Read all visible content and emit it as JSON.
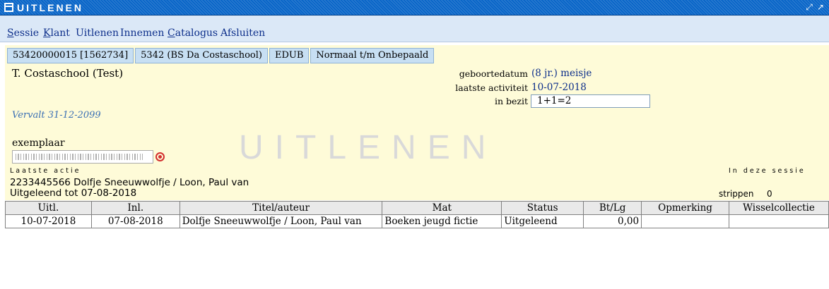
{
  "window": {
    "title": "UITLENEN",
    "restore_icon": "restore-icon",
    "maximize_icon": "maximize-icon"
  },
  "menu": [
    {
      "label": "Sessie",
      "underline": "S",
      "rest": "essie"
    },
    {
      "label": "Klant",
      "underline": "K",
      "rest": "lant"
    },
    {
      "label": "Uitlenen"
    },
    {
      "label": "Innemen"
    },
    {
      "label": "Catalogus",
      "underline": "C",
      "rest": "atalogus"
    },
    {
      "label": "Afsluiten"
    }
  ],
  "tabs": [
    "53420000015 [1562734]",
    "5342 (BS Da Costaschool)",
    "EDUB",
    "Normaal t/m Onbepaald"
  ],
  "patron": {
    "name": "T. Costaschool (Test)",
    "birthdate_label": "geboortedatum",
    "birthdate_value": "(8 jr.) meisje",
    "last_activity_label": "laatste activiteit",
    "last_activity_value": "10-07-2018",
    "in_possession_label": "in bezit",
    "in_possession_value": "1+1=2",
    "expires": "Vervalt 31-12-2099"
  },
  "scan": {
    "label": "exemplaar",
    "value": "",
    "target_icon": "target-icon"
  },
  "watermark": "UITLENEN",
  "last_action": {
    "label": "Laatste actie",
    "item": "2233445566 Dolfje Sneeuwwolfje / Loon, Paul van",
    "due": "Uitgeleend tot 07-08-2018"
  },
  "session": {
    "label": "In deze sessie",
    "strippen_label": "strippen",
    "strippen_value": "0"
  },
  "table": {
    "columns": [
      "Uitl.",
      "Inl.",
      "Titel/auteur",
      "Mat",
      "Status",
      "Bt/Lg",
      "Opmerking",
      "Wisselcollectie"
    ],
    "rows": [
      [
        "10-07-2018",
        "07-08-2018",
        "Dolfje Sneeuwwolfje / Loon, Paul van",
        "Boeken jeugd fictie",
        "Uitgeleend",
        "0,00",
        "",
        ""
      ]
    ]
  }
}
